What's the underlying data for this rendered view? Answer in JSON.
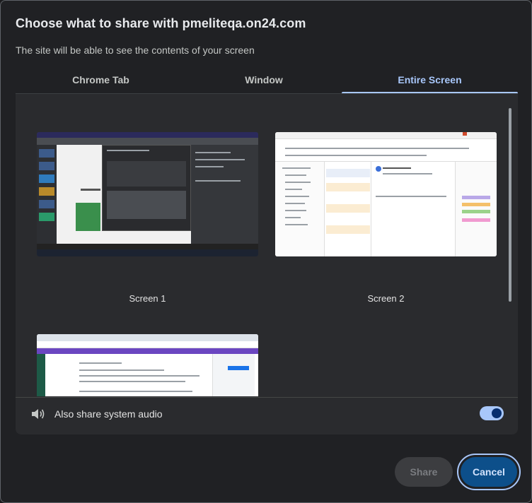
{
  "dialog": {
    "title": "Choose what to share with pmeliteqa.on24.com",
    "subtitle": "The site will be able to see the contents of your screen"
  },
  "tabs": [
    {
      "label": "Chrome Tab",
      "selected": false
    },
    {
      "label": "Window",
      "selected": false
    },
    {
      "label": "Entire Screen",
      "selected": true
    }
  ],
  "screens": [
    {
      "label": "Screen 1"
    },
    {
      "label": "Screen 2"
    },
    {
      "label": ""
    }
  ],
  "audio": {
    "label": "Also share system audio",
    "enabled": true,
    "icon": "speaker-icon"
  },
  "footer": {
    "share_label": "Share",
    "cancel_label": "Cancel",
    "share_enabled": false
  },
  "colors": {
    "accent": "#a8c7fa",
    "cancel_bg": "#0d4f8a",
    "dialog_bg": "#202124",
    "panel_bg": "#2a2b2e"
  }
}
